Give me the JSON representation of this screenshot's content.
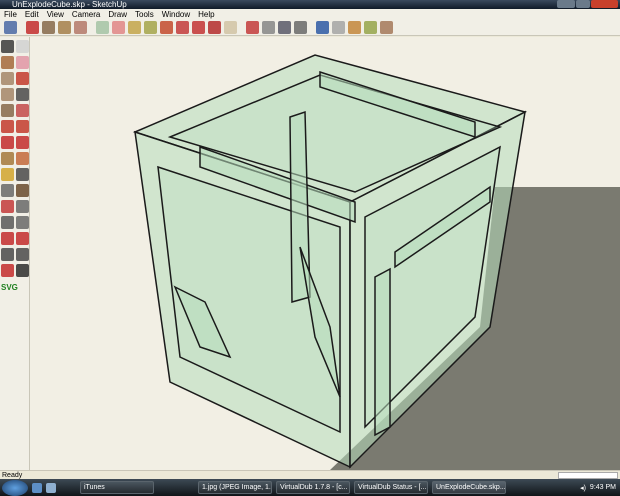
{
  "window": {
    "title": "UnExplodeCube.skp - SketchUp"
  },
  "menu": [
    "File",
    "Edit",
    "View",
    "Camera",
    "Draw",
    "Tools",
    "Window",
    "Help"
  ],
  "toolbar_icons": [
    "select-icon",
    "pencil-icon",
    "rectangle-icon",
    "circle-icon",
    "arc-icon",
    "make-component-icon",
    "eraser-icon",
    "tape-measure-icon",
    "paint-bucket-icon",
    "push-pull-icon",
    "move-icon",
    "rotate-icon",
    "follow-me-icon",
    "offset-icon",
    "orbit-icon",
    "pan-icon",
    "zoom-icon",
    "zoom-extents-icon",
    "get-models-icon",
    "share-model-icon",
    "place-model-icon",
    "component-icon",
    "dynamic-component-icon"
  ],
  "left_tools_label": "SVG",
  "status": {
    "text": "Ready"
  },
  "taskbar": {
    "items": [
      "iTunes",
      "1.jpg (JPEG Image, 1...",
      "VirtualDub 1.7.8 - [c...",
      "VirtualDub Status - [...",
      "UnExplodeCube.skp..."
    ],
    "clock": "9:43 PM"
  },
  "colors": {
    "glass": "#b7dcbc",
    "edge": "#1a1a1a",
    "shadow": "#7a7a70"
  }
}
